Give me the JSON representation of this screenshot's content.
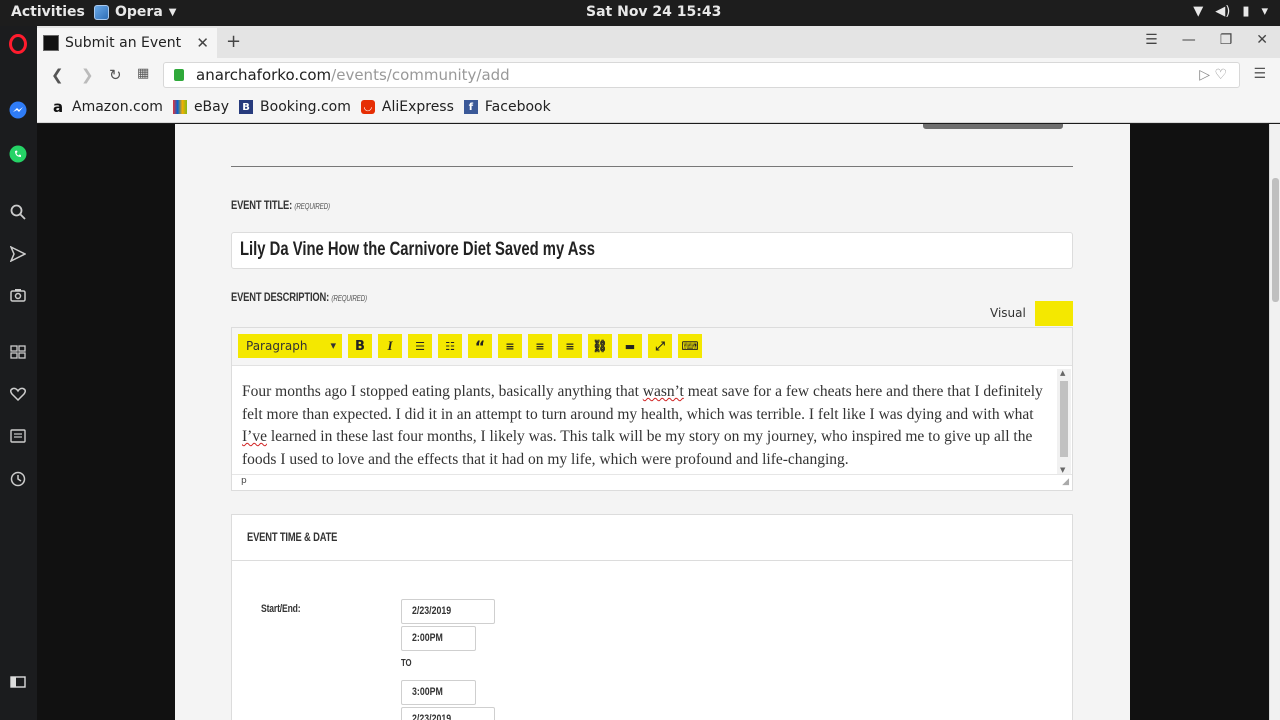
{
  "system": {
    "activities": "Activities",
    "app_name": "Opera",
    "clock": "Sat Nov 24  15:43"
  },
  "browser": {
    "tab_title": "Submit an Event",
    "url_domain": "anarchaforko.com",
    "url_path": "/events/community/add",
    "bookmarks": [
      {
        "label": "Amazon.com",
        "icon": "amazon-icon",
        "color": "#111111"
      },
      {
        "label": "eBay",
        "icon": "ebay-icon",
        "color": "#e53238"
      },
      {
        "label": "Booking.com",
        "icon": "booking-icon",
        "color": "#273b7d"
      },
      {
        "label": "AliExpress",
        "icon": "aliexpress-icon",
        "color": "#e62e04"
      },
      {
        "label": "Facebook",
        "icon": "facebook-icon",
        "color": "#3b5998"
      }
    ]
  },
  "form": {
    "title_label": "Event Title:",
    "required": "(required)",
    "title_value": "Lily Da Vine How the Carnivore Diet Saved my Ass",
    "description_label": "Event Description:",
    "visual_tab": "Visual",
    "format_select": "Paragraph",
    "description_parts": [
      "Four months ago I stopped eating plants, basically anything that ",
      "wasn’t",
      " meat save for a few cheats here and there that I definitely felt more than expected. I did it in an attempt to turn around my health, which was terrible. I felt like I was dying and with what ",
      "I’ve",
      " learned in these last four months, I likely was. This talk will be my story on my journey, who inspired me to give up all the foods I used to love and the effects that it had on my life, which were profound and life-changing."
    ],
    "path_status": "p",
    "time_section_title": "Event Time & Date",
    "start_end_label": "Start/End:",
    "start_date": "2/23/2019",
    "start_time": "2:00pm",
    "to_label": "to",
    "end_time": "3:00pm",
    "end_date": "2/23/2019"
  },
  "colors": {
    "accent": "#f4e800",
    "page_bg": "#f4f4f4"
  }
}
